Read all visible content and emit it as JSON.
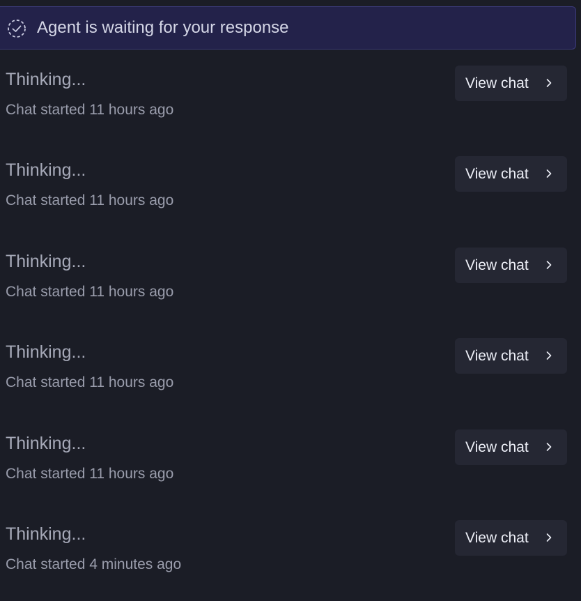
{
  "banner": {
    "icon": "dashed-check-circle-icon",
    "text": "Agent is waiting for your response"
  },
  "chats": [
    {
      "status": "Thinking...",
      "meta": "Chat started 11 hours ago",
      "button_label": "View chat",
      "button_icon": "chevron-right-icon"
    },
    {
      "status": "Thinking...",
      "meta": "Chat started 11 hours ago",
      "button_label": "View chat",
      "button_icon": "chevron-right-icon"
    },
    {
      "status": "Thinking...",
      "meta": "Chat started 11 hours ago",
      "button_label": "View chat",
      "button_icon": "chevron-right-icon"
    },
    {
      "status": "Thinking...",
      "meta": "Chat started 11 hours ago",
      "button_label": "View chat",
      "button_icon": "chevron-right-icon"
    },
    {
      "status": "Thinking...",
      "meta": "Chat started 11 hours ago",
      "button_label": "View chat",
      "button_icon": "chevron-right-icon"
    },
    {
      "status": "Thinking...",
      "meta": "Chat started 4 minutes ago",
      "button_label": "View chat",
      "button_icon": "chevron-right-icon"
    }
  ],
  "colors": {
    "background": "#1b1d26",
    "banner_background": "#23224a",
    "banner_border": "#3b3a78",
    "button_background": "#252733"
  }
}
